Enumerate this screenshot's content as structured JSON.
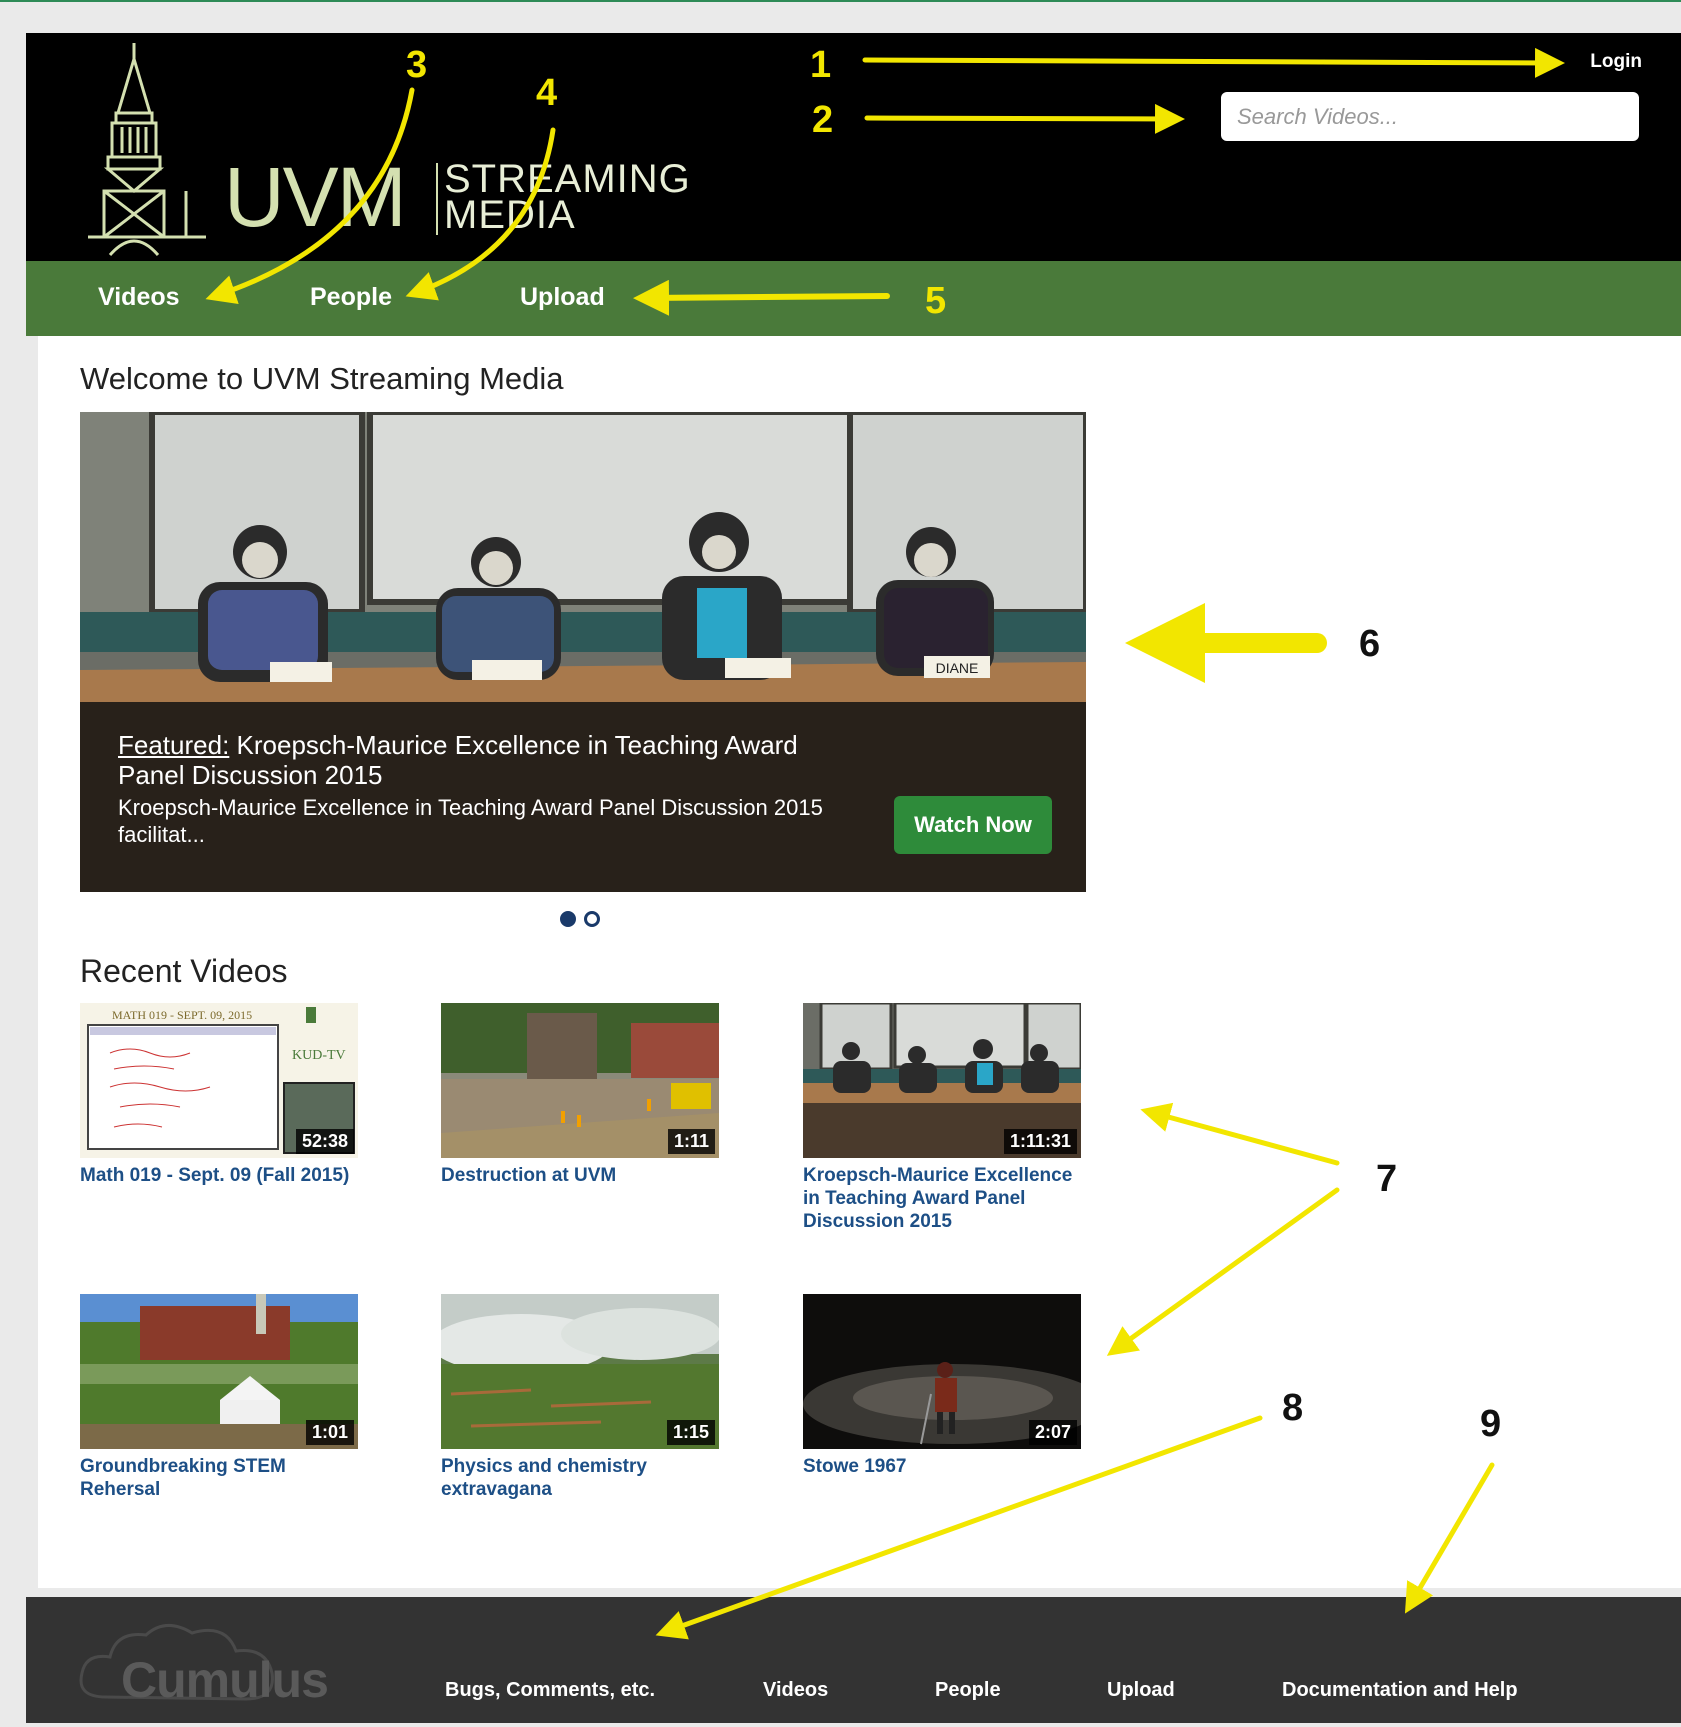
{
  "header": {
    "logo": {
      "primary": "UVM",
      "line1": "STREAMING",
      "line2": "MEDIA"
    },
    "login_label": "Login",
    "search_placeholder": "Search Videos..."
  },
  "nav": {
    "items": [
      "Videos",
      "People",
      "Upload"
    ]
  },
  "main": {
    "welcome_heading": "Welcome to UVM Streaming Media",
    "featured": {
      "label": "Featured:",
      "title": "Kroepsch-Maurice Excellence in Teaching Award Panel Discussion 2015",
      "description": "Kroepsch-Maurice Excellence in Teaching Award Panel Discussion 2015 facilitat...",
      "watch_label": "Watch Now",
      "nameplates": [
        "DIANE"
      ],
      "carousel_dots": 2,
      "active_dot": 0
    },
    "recent_heading": "Recent Videos",
    "videos": [
      {
        "title": "Math 019 - Sept. 09 (Fall 2015)",
        "duration": "52:38",
        "thumb_text": "MATH 019 - SEPT. 09, 2015",
        "thumb_badge": "KUD-TV"
      },
      {
        "title": "Destruction at UVM",
        "duration": "1:11"
      },
      {
        "title": "Kroepsch-Maurice Excellence in Teaching Award Panel Discussion 2015",
        "duration": "1:11:31"
      },
      {
        "title": "Groundbreaking STEM Rehersal",
        "duration": "1:01"
      },
      {
        "title": "Physics and chemistry extravagana",
        "duration": "1:15"
      },
      {
        "title": "Stowe 1967",
        "duration": "2:07"
      }
    ]
  },
  "footer": {
    "logo_text": "Cumulus",
    "links": [
      "Bugs, Comments, etc.",
      "Videos",
      "People",
      "Upload",
      "Documentation and Help"
    ]
  },
  "annotations": [
    "1",
    "2",
    "3",
    "4",
    "5",
    "6",
    "7",
    "8",
    "9"
  ],
  "colors": {
    "header_bg": "#000000",
    "nav_bg": "#4a7a3a",
    "footer_bg": "#333333",
    "link_blue": "#1d4f86",
    "watch_green": "#2e8b3a",
    "annotation_yellow": "#f2e600"
  }
}
